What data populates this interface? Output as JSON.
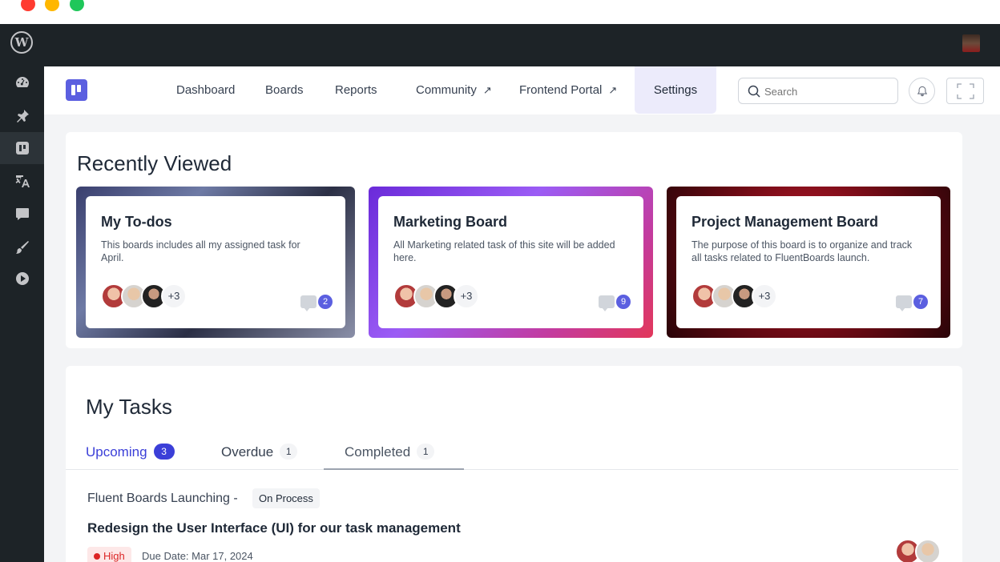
{
  "window": {
    "controls": [
      "close",
      "minimize",
      "maximize"
    ]
  },
  "admin_bar": {
    "logo_icon": "wordpress-icon",
    "user_avatar": "user-avatar"
  },
  "sidebar": {
    "items": [
      {
        "icon": "dashboard-gauge-icon"
      },
      {
        "icon": "pin-icon"
      },
      {
        "icon": "fluent-boards-icon",
        "active": true
      },
      {
        "icon": "translate-icon"
      },
      {
        "icon": "comments-icon"
      },
      {
        "icon": "brush-icon"
      },
      {
        "icon": "play-icon"
      }
    ]
  },
  "nav": {
    "items": [
      {
        "label": "Dashboard"
      },
      {
        "label": "Boards"
      },
      {
        "label": "Reports"
      },
      {
        "label": "Community",
        "external": "↗"
      },
      {
        "label": "Frontend Portal",
        "external": "↗"
      }
    ],
    "settings": "Settings",
    "search_placeholder": "Search"
  },
  "recently_viewed": {
    "title": "Recently Viewed",
    "boards": [
      {
        "title": "My To-dos",
        "description": "This boards includes all my assigned task for April.",
        "more_members": "+3",
        "comments": "2"
      },
      {
        "title": "Marketing Board",
        "description": "All Marketing related task of this site will be added here.",
        "more_members": "+3",
        "comments": "9"
      },
      {
        "title": "Project Management Board",
        "description": "The purpose of this board is to organize and track all tasks related to FluentBoards launch.",
        "more_members": "+3",
        "comments": "7"
      }
    ]
  },
  "my_tasks": {
    "title": "My Tasks",
    "tabs": [
      {
        "label": "Upcoming",
        "count": "3"
      },
      {
        "label": "Overdue",
        "count": "1"
      },
      {
        "label": "Completed",
        "count": "1"
      }
    ],
    "task": {
      "project": "Fluent Boards Launching",
      "separator": "-",
      "status": "On Process",
      "title": "Redesign the User Interface (UI) for our task management",
      "priority": "High",
      "due": "Due Date: Mar 17, 2024"
    }
  },
  "colors": {
    "accent": "#5b5fe0",
    "tab_active": "#3b3fd8",
    "priority_high": "#dc2626",
    "admin_bg": "#1d2327"
  }
}
